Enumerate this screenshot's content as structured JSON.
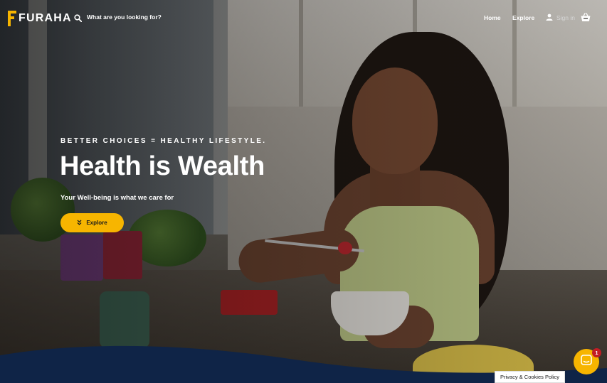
{
  "brand": {
    "name": "FURAHA",
    "accent_color": "#f7b500"
  },
  "search": {
    "placeholder": "What are you looking for?",
    "icon": "search-icon"
  },
  "nav": {
    "links": [
      {
        "label": "Home"
      },
      {
        "label": "Explore"
      }
    ],
    "signin_label": "Sign in",
    "signin_icon": "user-icon",
    "cart_icon": "basket-icon"
  },
  "hero": {
    "tagline": "BETTER CHOICES = HEALTHY LIFESTYLE.",
    "headline": "Health is Wealth",
    "subtitle": "Your Well-being is what we care for",
    "cta_label": "Explore",
    "cta_icon": "double-chevron-down-icon"
  },
  "chat": {
    "unread_count": "1",
    "icon": "chat-icon"
  },
  "cookie_policy": {
    "label": "Privacy & Cookies Policy"
  },
  "colors": {
    "navy": "#0f2447",
    "badge": "#c21d25"
  }
}
